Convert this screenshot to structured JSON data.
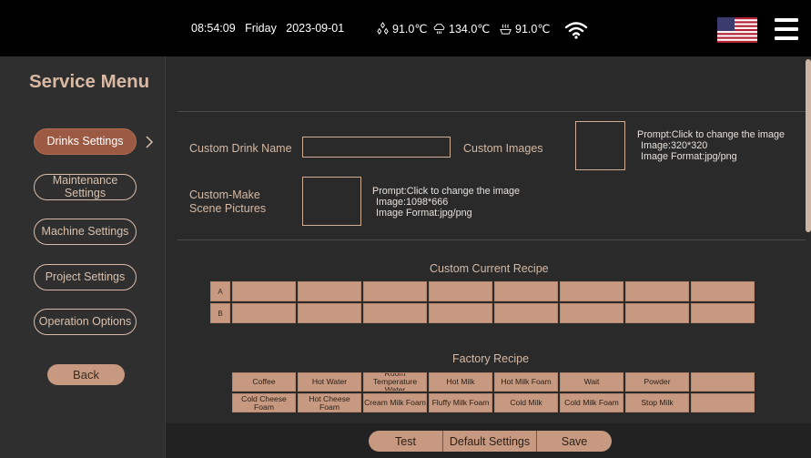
{
  "status": {
    "time": "08:54:09",
    "day": "Friday",
    "date": "2023-09-01",
    "temp1": "91.0℃",
    "temp2": "134.0℃",
    "temp3": "91.0℃"
  },
  "sidebar": {
    "title": "Service Menu",
    "items": [
      {
        "label": "Drinks Settings"
      },
      {
        "label": "Maintenance Settings"
      },
      {
        "label": "Machine Settings"
      },
      {
        "label": "Project Settings"
      },
      {
        "label": "Operation Options"
      }
    ],
    "back": "Back"
  },
  "form": {
    "custom_drink_name": "Custom Drink Name",
    "custom_images": "Custom Images",
    "images_prompt": [
      "Prompt:Click to change the image",
      "Image:320*320",
      "Image Format:jpg/png"
    ],
    "scene_label_1": "Custom-Make",
    "scene_label_2": "Scene Pictures",
    "scene_prompt": [
      "Prompt:Click to change the image",
      "Image:1098*666",
      "Image Format:jpg/png"
    ]
  },
  "recipe": {
    "current_title": "Custom Current Recipe",
    "rows": [
      "A",
      "B"
    ],
    "factory_title": "Factory Recipe",
    "factory_row1": [
      "Coffee",
      "Hot Water",
      "Room Temperature Water",
      "Hot Milk",
      "Hot Milk Foam",
      "Wait",
      "Powder",
      ""
    ],
    "factory_row2": [
      "Cold Cheese Foam",
      "Hot Cheese Foam",
      "Cream Milk Foam",
      "Fluffy Milk Foam",
      "Cold Milk",
      "Cold Milk Foam",
      "Stop Milk",
      ""
    ]
  },
  "actions": {
    "test": "Test",
    "default": "Default Settings",
    "save": "Save"
  },
  "colors": {
    "accent": "#c69980",
    "active": "#9c5a44"
  }
}
